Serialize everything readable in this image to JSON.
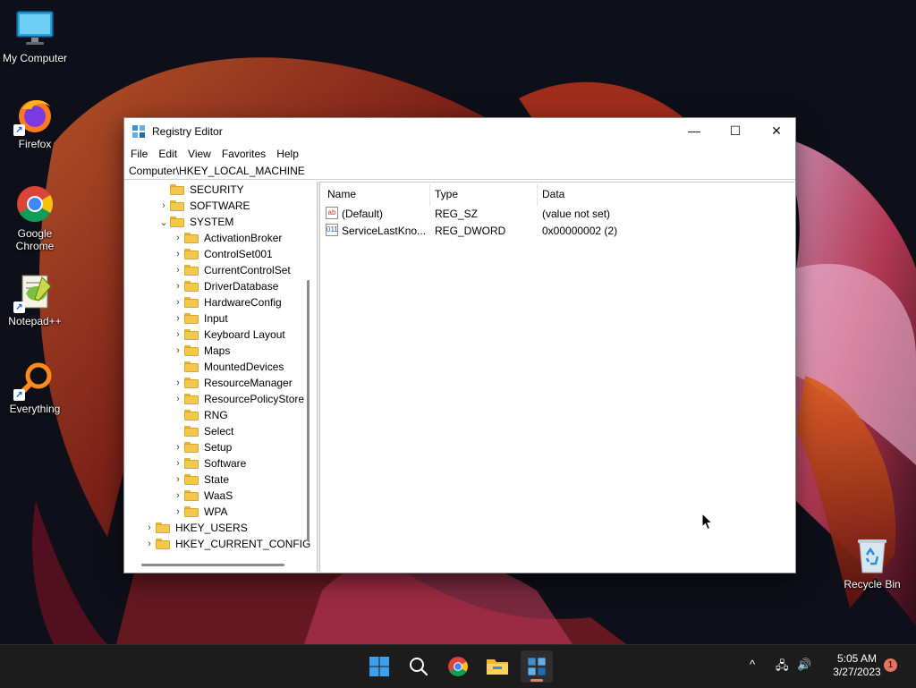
{
  "desktop": {
    "icons": [
      {
        "label": "My Computer"
      },
      {
        "label": "Firefox"
      },
      {
        "label": "Google Chrome"
      },
      {
        "label": "Notepad++"
      },
      {
        "label": "Everything"
      },
      {
        "label": "Recycle Bin"
      }
    ]
  },
  "window": {
    "title": "Registry Editor",
    "controls": {
      "minimize": "—",
      "maximize": "☐",
      "close": "✕"
    },
    "menu": [
      "File",
      "Edit",
      "View",
      "Favorites",
      "Help"
    ],
    "address": "Computer\\HKEY_LOCAL_MACHINE",
    "tree": [
      {
        "label": "SECURITY",
        "expander": ""
      },
      {
        "label": "SOFTWARE",
        "expander": "›"
      },
      {
        "label": "SYSTEM",
        "expander": "⌄"
      },
      {
        "label": "ActivationBroker",
        "expander": "›"
      },
      {
        "label": "ControlSet001",
        "expander": "›"
      },
      {
        "label": "CurrentControlSet",
        "expander": "›"
      },
      {
        "label": "DriverDatabase",
        "expander": "›"
      },
      {
        "label": "HardwareConfig",
        "expander": "›"
      },
      {
        "label": "Input",
        "expander": "›"
      },
      {
        "label": "Keyboard Layout",
        "expander": "›"
      },
      {
        "label": "Maps",
        "expander": "›"
      },
      {
        "label": "MountedDevices",
        "expander": ""
      },
      {
        "label": "ResourceManager",
        "expander": "›"
      },
      {
        "label": "ResourcePolicyStore",
        "expander": "›"
      },
      {
        "label": "RNG",
        "expander": ""
      },
      {
        "label": "Select",
        "expander": ""
      },
      {
        "label": "Setup",
        "expander": "›"
      },
      {
        "label": "Software",
        "expander": "›"
      },
      {
        "label": "State",
        "expander": "›"
      },
      {
        "label": "WaaS",
        "expander": "›"
      },
      {
        "label": "WPA",
        "expander": "›"
      },
      {
        "label": "HKEY_USERS",
        "expander": "›"
      },
      {
        "label": "HKEY_CURRENT_CONFIG",
        "expander": "›"
      }
    ],
    "columns": {
      "name": "Name",
      "type": "Type",
      "data": "Data"
    },
    "values": [
      {
        "icon": "ab",
        "name": "(Default)",
        "type": "REG_SZ",
        "data": "(value not set)"
      },
      {
        "icon": "011",
        "name": "ServiceLastKno...",
        "type": "REG_DWORD",
        "data": "0x00000002 (2)"
      }
    ]
  },
  "taskbar": {
    "apps": [
      "start-icon",
      "search-icon",
      "chrome-icon",
      "file-explorer-icon",
      "registry-editor-icon"
    ],
    "tray": {
      "chevron": "^",
      "network": "🖧",
      "volume": "🔊"
    },
    "clock": {
      "time": "5:05 AM",
      "date": "3/27/2023"
    },
    "notifications": "1"
  },
  "colors": {
    "accent": "#0078d4",
    "taskbar": "#1c1c1c",
    "folder": "#f2c94c"
  }
}
